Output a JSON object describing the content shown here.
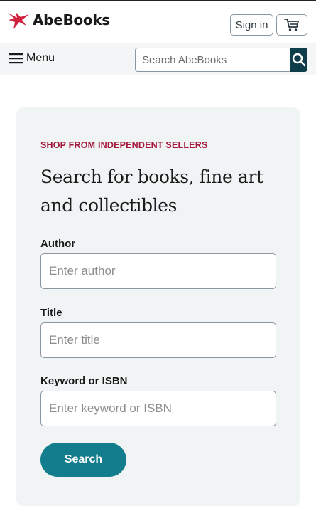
{
  "header": {
    "logo_text": "AbeBooks",
    "logo_icon": "abebooks-bird-icon",
    "signin_label": "Sign in",
    "cart_icon": "cart-icon"
  },
  "nav": {
    "menu_label": "Menu",
    "menu_icon": "hamburger-icon",
    "search_placeholder": "Search AbeBooks",
    "search_icon": "search-icon"
  },
  "search_form": {
    "eyebrow": "SHOP FROM INDEPENDENT SELLERS",
    "heading": "Search for books, fine art and collectibles",
    "fields": [
      {
        "label": "Author",
        "placeholder": "Enter author",
        "value": ""
      },
      {
        "label": "Title",
        "placeholder": "Enter title",
        "value": ""
      },
      {
        "label": "Keyword or ISBN",
        "placeholder": "Enter keyword or ISBN",
        "value": ""
      }
    ],
    "submit_label": "Search"
  },
  "colors": {
    "brand_red": "#d0223f",
    "eyebrow_red": "#a3173b",
    "search_button_navy": "#0f3d49",
    "submit_teal": "#137d8d",
    "card_background": "#f1f4f5"
  }
}
